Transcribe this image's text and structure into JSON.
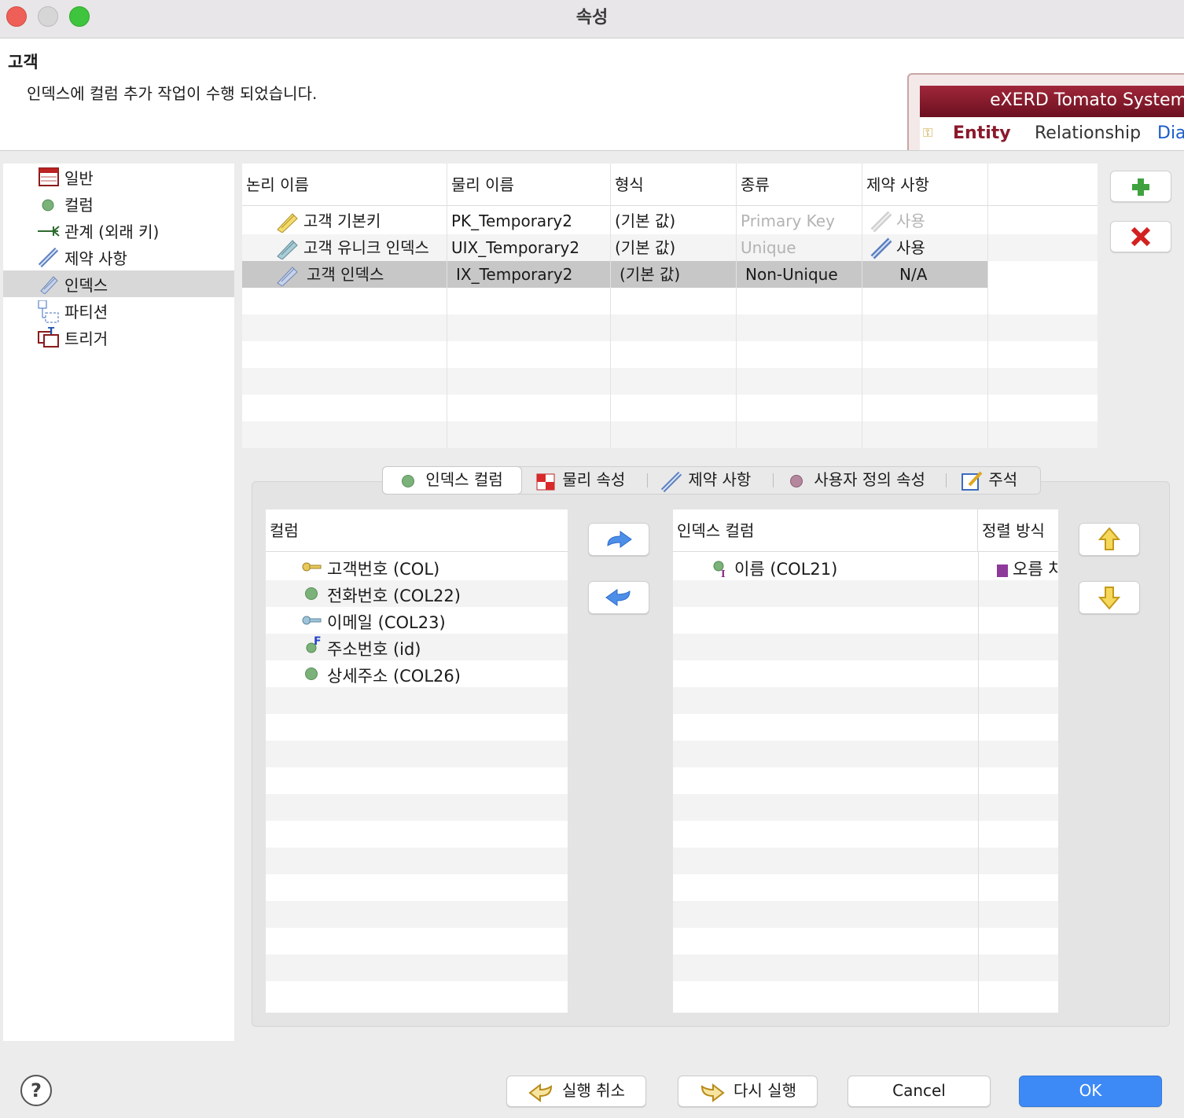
{
  "window": {
    "title": "속성"
  },
  "header": {
    "entity_name": "고객",
    "message": "인덱스에 컬럼 추가 작업이 수행 되었습니다."
  },
  "banner": {
    "title": "eXERD  Tomato System",
    "tabs": [
      "Entity",
      "Relationship",
      "Dia"
    ]
  },
  "nav": {
    "items": [
      {
        "label": "일반",
        "icon": "table-icon"
      },
      {
        "label": "컬럼",
        "icon": "column-dot-icon"
      },
      {
        "label": "관계 (외래 키)",
        "icon": "relation-icon"
      },
      {
        "label": "제약 사항",
        "icon": "constraint-icon"
      },
      {
        "label": "인덱스",
        "icon": "index-icon",
        "selected": true
      },
      {
        "label": "파티션",
        "icon": "partition-icon"
      },
      {
        "label": "트리거",
        "icon": "trigger-icon"
      }
    ]
  },
  "index_table": {
    "columns": [
      "논리 이름",
      "물리 이름",
      "형식",
      "종류",
      "제약 사항"
    ],
    "rows": [
      {
        "logical": "고객 기본키",
        "physical": "PK_Temporary2",
        "format": "(기본 값)",
        "kind": "Primary Key",
        "constraint": "사용",
        "kind_disabled": true,
        "constraint_disabled": true
      },
      {
        "logical": "고객 유니크 인덱스",
        "physical": "UIX_Temporary2",
        "format": "(기본 값)",
        "kind": "Unique",
        "constraint": "사용",
        "kind_disabled": true,
        "constraint_disabled": false
      },
      {
        "logical": "고객 인덱스",
        "physical": "IX_Temporary2",
        "format": "(기본 값)",
        "kind": "Non-Unique",
        "constraint": "N/A",
        "selected": true
      }
    ]
  },
  "tabs": [
    {
      "label": "인덱스 컬럼",
      "icon": "column-dot-icon",
      "active": true
    },
    {
      "label": "물리 속성",
      "icon": "physical-icon"
    },
    {
      "label": "제약 사항",
      "icon": "constraint-icon"
    },
    {
      "label": "사용자 정의 속성",
      "icon": "custom-dot-icon"
    },
    {
      "label": "주석",
      "icon": "comment-icon"
    }
  ],
  "columns_list": {
    "header": "컬럼",
    "items": [
      {
        "label": "고객번호 (COL)",
        "icon": "primary-key-icon"
      },
      {
        "label": "전화번호 (COL22)",
        "icon": "column-dot-icon"
      },
      {
        "label": "이메일 (COL23)",
        "icon": "unique-key-icon"
      },
      {
        "label": "주소번호 (id)",
        "icon": "foreign-key-icon"
      },
      {
        "label": "상세주소 (COL26)",
        "icon": "column-dot-icon"
      }
    ]
  },
  "index_columns": {
    "header_column": "인덱스 컬럼",
    "header_sort": "정렬 방식",
    "items": [
      {
        "label": "이름 (COL21)",
        "sort": "오름 차",
        "icon": "index-column-icon"
      }
    ]
  },
  "buttons": {
    "undo": "실행 취소",
    "redo": "다시 실행",
    "cancel": "Cancel",
    "ok": "OK",
    "help": "?"
  },
  "colors": {
    "accent": "#3d8af7",
    "banner": "#8a1a2c",
    "selected_row": "#c7c7c7"
  }
}
